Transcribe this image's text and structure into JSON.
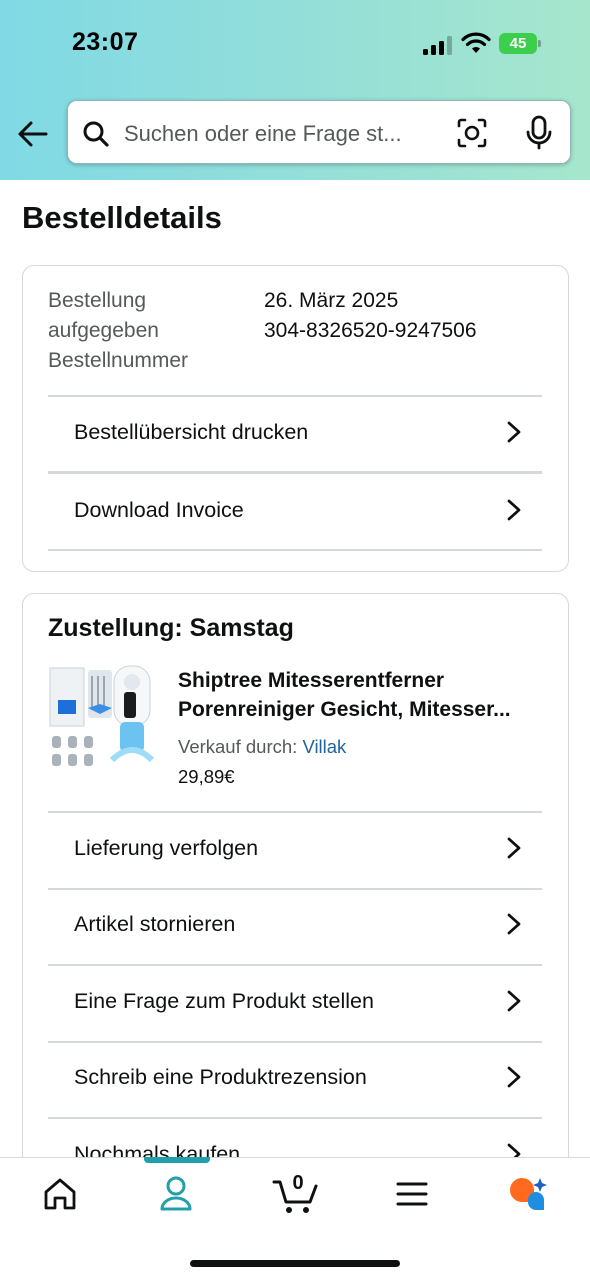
{
  "status_bar": {
    "time": "23:07",
    "battery": "45"
  },
  "search": {
    "placeholder": "Suchen oder eine Frage st..."
  },
  "page_title": "Bestelldetails",
  "order_info": {
    "labels": [
      "Bestellung",
      "aufgegeben",
      "Bestellnummer"
    ],
    "date": "26. März 2025",
    "order_number": "304-8326520-9247506"
  },
  "order_actions": [
    {
      "label": "Bestellübersicht drucken"
    },
    {
      "label": "Download Invoice"
    }
  ],
  "delivery": {
    "title": "Zustellung: Samstag",
    "product": {
      "name_line1": "Shiptree Mitesserentferner",
      "name_line2": "Porenreiniger Gesicht, Mitesser...",
      "seller_prefix": "Verkauf durch:",
      "seller": "Villak",
      "price": "29,89€"
    },
    "actions": [
      {
        "label": "Lieferung verfolgen"
      },
      {
        "label": "Artikel stornieren"
      },
      {
        "label": "Eine Frage zum Produkt stellen"
      },
      {
        "label": "Schreib eine Produktrezension"
      },
      {
        "label": "Nochmals kaufen"
      }
    ]
  },
  "bottom_nav": {
    "cart_count": "0",
    "items": [
      "home-icon",
      "account-icon",
      "cart-icon",
      "menu-icon",
      "rufus-assistant-icon"
    ],
    "active": "account-icon"
  },
  "colors": {
    "accent": "#21a0aa",
    "link": "#2162a1",
    "header_gradient": [
      "#80d9e4",
      "#a6e6cd"
    ],
    "battery": "#3ccf4e"
  }
}
